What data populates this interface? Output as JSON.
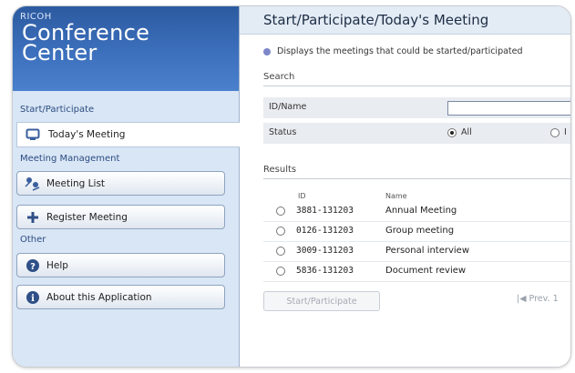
{
  "brand": {
    "small": "RICOH",
    "line1": "Conference",
    "line2": "Center"
  },
  "sidebar": {
    "section_start": "Start/Participate",
    "todays_meeting": "Today's Meeting",
    "section_manage": "Meeting Management",
    "meeting_list": "Meeting List",
    "register_meeting": "Register Meeting",
    "section_other": "Other",
    "help": "Help",
    "about": "About this Application"
  },
  "main": {
    "title": "Start/Participate/Today's Meeting",
    "info": "Displays the meetings that could be started/participated",
    "search_label": "Search",
    "id_name_label": "ID/Name",
    "status_label": "Status",
    "status_all": "All",
    "status_other": "I",
    "results_label": "Results",
    "col_id": "ID",
    "col_name": "Name",
    "rows": [
      {
        "id": "3881-131203",
        "name": "Annual Meeting"
      },
      {
        "id": "0126-131203",
        "name": "Group meeting"
      },
      {
        "id": "3009-131203",
        "name": "Personal interview"
      },
      {
        "id": "5836-131203",
        "name": "Document review"
      }
    ],
    "start_button": "Start/Participate",
    "prev": "Prev. 1"
  },
  "colors": {
    "brand_blue": "#2c5aa0",
    "sidebar_bg": "#d9e6f5",
    "info_dot": "#7b87c9"
  }
}
